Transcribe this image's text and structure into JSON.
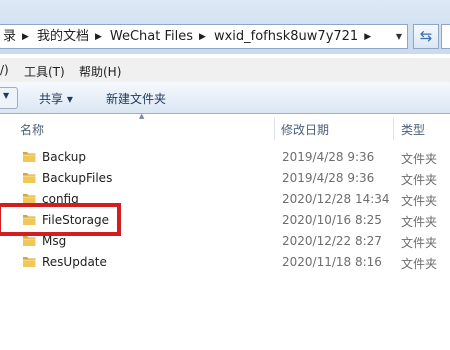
{
  "address": {
    "crumbs": [
      "录",
      "我的文档",
      "WeChat Files",
      "wxid_fofhsk8uw7y721"
    ],
    "dropdown_icon": "chevron-down-icon",
    "refresh_icon": "refresh-icon"
  },
  "menu": {
    "items": [
      "/)",
      "工具(T)",
      "帮助(H)"
    ]
  },
  "toolbar": {
    "share_label": "共享 ▾",
    "new_folder_label": "新建文件夹"
  },
  "columns": {
    "name": "名称",
    "modified": "修改日期",
    "type": "类型"
  },
  "files": [
    {
      "name": "Backup",
      "modified": "2019/4/28 9:36",
      "type": "文件夹"
    },
    {
      "name": "BackupFiles",
      "modified": "2019/4/28 9:36",
      "type": "文件夹"
    },
    {
      "name": "config",
      "modified": "2020/12/28 14:34",
      "type": "文件夹"
    },
    {
      "name": "FileStorage",
      "modified": "2020/10/16 8:25",
      "type": "文件夹"
    },
    {
      "name": "Msg",
      "modified": "2020/12/22 8:27",
      "type": "文件夹"
    },
    {
      "name": "ResUpdate",
      "modified": "2020/11/18 8:16",
      "type": "文件夹"
    }
  ],
  "colors": {
    "highlight": "#d21e1e",
    "folder": "#e8b84a"
  }
}
